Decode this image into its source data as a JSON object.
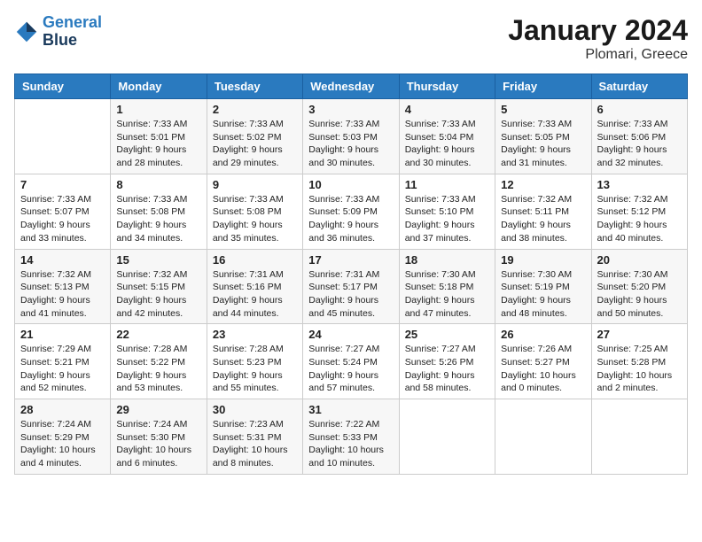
{
  "header": {
    "logo_line1": "General",
    "logo_line2": "Blue",
    "month": "January 2024",
    "location": "Plomari, Greece"
  },
  "days_of_week": [
    "Sunday",
    "Monday",
    "Tuesday",
    "Wednesday",
    "Thursday",
    "Friday",
    "Saturday"
  ],
  "weeks": [
    [
      {
        "day": "",
        "sunrise": "",
        "sunset": "",
        "daylight": ""
      },
      {
        "day": "1",
        "sunrise": "Sunrise: 7:33 AM",
        "sunset": "Sunset: 5:01 PM",
        "daylight": "Daylight: 9 hours and 28 minutes."
      },
      {
        "day": "2",
        "sunrise": "Sunrise: 7:33 AM",
        "sunset": "Sunset: 5:02 PM",
        "daylight": "Daylight: 9 hours and 29 minutes."
      },
      {
        "day": "3",
        "sunrise": "Sunrise: 7:33 AM",
        "sunset": "Sunset: 5:03 PM",
        "daylight": "Daylight: 9 hours and 30 minutes."
      },
      {
        "day": "4",
        "sunrise": "Sunrise: 7:33 AM",
        "sunset": "Sunset: 5:04 PM",
        "daylight": "Daylight: 9 hours and 30 minutes."
      },
      {
        "day": "5",
        "sunrise": "Sunrise: 7:33 AM",
        "sunset": "Sunset: 5:05 PM",
        "daylight": "Daylight: 9 hours and 31 minutes."
      },
      {
        "day": "6",
        "sunrise": "Sunrise: 7:33 AM",
        "sunset": "Sunset: 5:06 PM",
        "daylight": "Daylight: 9 hours and 32 minutes."
      }
    ],
    [
      {
        "day": "7",
        "sunrise": "Sunrise: 7:33 AM",
        "sunset": "Sunset: 5:07 PM",
        "daylight": "Daylight: 9 hours and 33 minutes."
      },
      {
        "day": "8",
        "sunrise": "Sunrise: 7:33 AM",
        "sunset": "Sunset: 5:08 PM",
        "daylight": "Daylight: 9 hours and 34 minutes."
      },
      {
        "day": "9",
        "sunrise": "Sunrise: 7:33 AM",
        "sunset": "Sunset: 5:08 PM",
        "daylight": "Daylight: 9 hours and 35 minutes."
      },
      {
        "day": "10",
        "sunrise": "Sunrise: 7:33 AM",
        "sunset": "Sunset: 5:09 PM",
        "daylight": "Daylight: 9 hours and 36 minutes."
      },
      {
        "day": "11",
        "sunrise": "Sunrise: 7:33 AM",
        "sunset": "Sunset: 5:10 PM",
        "daylight": "Daylight: 9 hours and 37 minutes."
      },
      {
        "day": "12",
        "sunrise": "Sunrise: 7:32 AM",
        "sunset": "Sunset: 5:11 PM",
        "daylight": "Daylight: 9 hours and 38 minutes."
      },
      {
        "day": "13",
        "sunrise": "Sunrise: 7:32 AM",
        "sunset": "Sunset: 5:12 PM",
        "daylight": "Daylight: 9 hours and 40 minutes."
      }
    ],
    [
      {
        "day": "14",
        "sunrise": "Sunrise: 7:32 AM",
        "sunset": "Sunset: 5:13 PM",
        "daylight": "Daylight: 9 hours and 41 minutes."
      },
      {
        "day": "15",
        "sunrise": "Sunrise: 7:32 AM",
        "sunset": "Sunset: 5:15 PM",
        "daylight": "Daylight: 9 hours and 42 minutes."
      },
      {
        "day": "16",
        "sunrise": "Sunrise: 7:31 AM",
        "sunset": "Sunset: 5:16 PM",
        "daylight": "Daylight: 9 hours and 44 minutes."
      },
      {
        "day": "17",
        "sunrise": "Sunrise: 7:31 AM",
        "sunset": "Sunset: 5:17 PM",
        "daylight": "Daylight: 9 hours and 45 minutes."
      },
      {
        "day": "18",
        "sunrise": "Sunrise: 7:30 AM",
        "sunset": "Sunset: 5:18 PM",
        "daylight": "Daylight: 9 hours and 47 minutes."
      },
      {
        "day": "19",
        "sunrise": "Sunrise: 7:30 AM",
        "sunset": "Sunset: 5:19 PM",
        "daylight": "Daylight: 9 hours and 48 minutes."
      },
      {
        "day": "20",
        "sunrise": "Sunrise: 7:30 AM",
        "sunset": "Sunset: 5:20 PM",
        "daylight": "Daylight: 9 hours and 50 minutes."
      }
    ],
    [
      {
        "day": "21",
        "sunrise": "Sunrise: 7:29 AM",
        "sunset": "Sunset: 5:21 PM",
        "daylight": "Daylight: 9 hours and 52 minutes."
      },
      {
        "day": "22",
        "sunrise": "Sunrise: 7:28 AM",
        "sunset": "Sunset: 5:22 PM",
        "daylight": "Daylight: 9 hours and 53 minutes."
      },
      {
        "day": "23",
        "sunrise": "Sunrise: 7:28 AM",
        "sunset": "Sunset: 5:23 PM",
        "daylight": "Daylight: 9 hours and 55 minutes."
      },
      {
        "day": "24",
        "sunrise": "Sunrise: 7:27 AM",
        "sunset": "Sunset: 5:24 PM",
        "daylight": "Daylight: 9 hours and 57 minutes."
      },
      {
        "day": "25",
        "sunrise": "Sunrise: 7:27 AM",
        "sunset": "Sunset: 5:26 PM",
        "daylight": "Daylight: 9 hours and 58 minutes."
      },
      {
        "day": "26",
        "sunrise": "Sunrise: 7:26 AM",
        "sunset": "Sunset: 5:27 PM",
        "daylight": "Daylight: 10 hours and 0 minutes."
      },
      {
        "day": "27",
        "sunrise": "Sunrise: 7:25 AM",
        "sunset": "Sunset: 5:28 PM",
        "daylight": "Daylight: 10 hours and 2 minutes."
      }
    ],
    [
      {
        "day": "28",
        "sunrise": "Sunrise: 7:24 AM",
        "sunset": "Sunset: 5:29 PM",
        "daylight": "Daylight: 10 hours and 4 minutes."
      },
      {
        "day": "29",
        "sunrise": "Sunrise: 7:24 AM",
        "sunset": "Sunset: 5:30 PM",
        "daylight": "Daylight: 10 hours and 6 minutes."
      },
      {
        "day": "30",
        "sunrise": "Sunrise: 7:23 AM",
        "sunset": "Sunset: 5:31 PM",
        "daylight": "Daylight: 10 hours and 8 minutes."
      },
      {
        "day": "31",
        "sunrise": "Sunrise: 7:22 AM",
        "sunset": "Sunset: 5:33 PM",
        "daylight": "Daylight: 10 hours and 10 minutes."
      },
      {
        "day": "",
        "sunrise": "",
        "sunset": "",
        "daylight": ""
      },
      {
        "day": "",
        "sunrise": "",
        "sunset": "",
        "daylight": ""
      },
      {
        "day": "",
        "sunrise": "",
        "sunset": "",
        "daylight": ""
      }
    ]
  ]
}
